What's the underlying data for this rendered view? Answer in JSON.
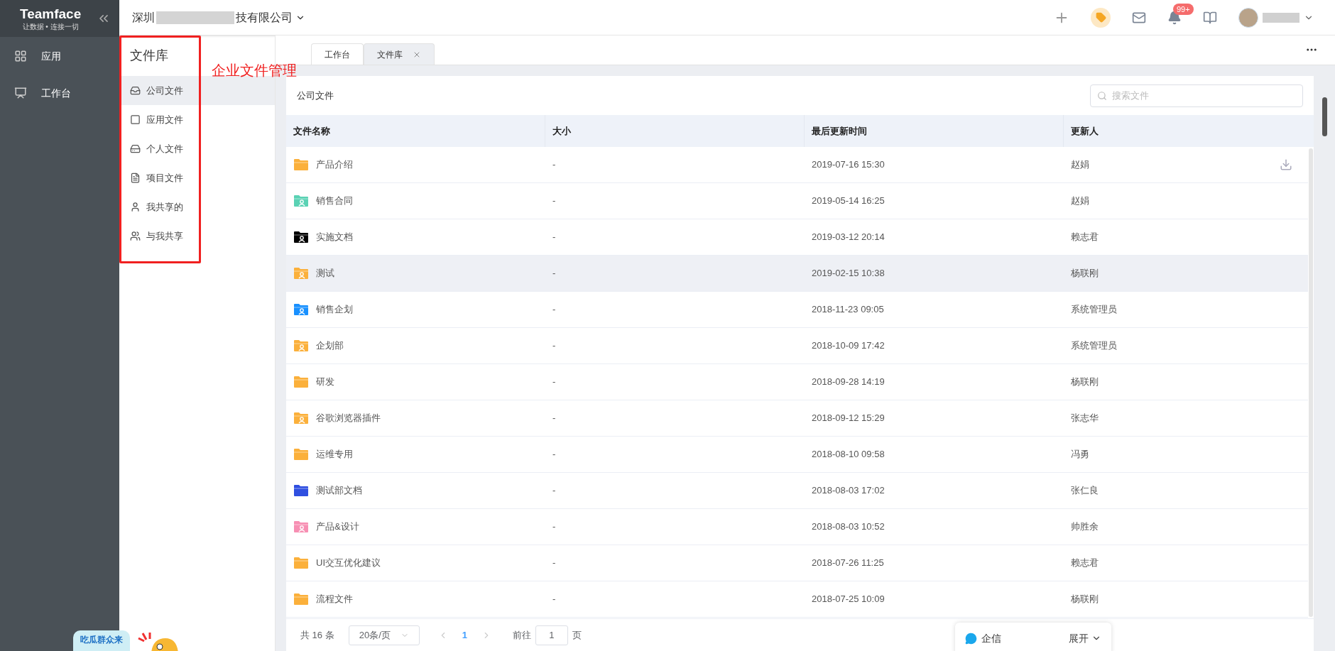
{
  "brand": {
    "name": "Teamface",
    "slogan": "让数据 • 连接一切"
  },
  "nav": [
    {
      "label": "应用",
      "kind": "apps"
    },
    {
      "label": "工作台",
      "kind": "dashboard"
    }
  ],
  "company": {
    "prefix": "深圳",
    "suffix": "技有限公司"
  },
  "header": {
    "badge": "99+"
  },
  "library": {
    "title": "文件库",
    "annotation": "企业文件管理",
    "items": [
      {
        "label": "公司文件",
        "kind": "inbox",
        "selected": true
      },
      {
        "label": "应用文件",
        "kind": "app",
        "selected": false
      },
      {
        "label": "个人文件",
        "kind": "drive",
        "selected": false
      },
      {
        "label": "项目文件",
        "kind": "project",
        "selected": false
      },
      {
        "label": "我共享的",
        "kind": "user",
        "selected": false
      },
      {
        "label": "与我共享",
        "kind": "shared",
        "selected": false
      }
    ]
  },
  "tabs": [
    {
      "label": "工作台",
      "selected": false,
      "closable": false
    },
    {
      "label": "文件库",
      "selected": true,
      "closable": true
    }
  ],
  "toolbar": {
    "title": "公司文件",
    "search": {
      "placeholder": "搜索文件"
    }
  },
  "table": {
    "columns": [
      "文件名称",
      "大小",
      "最后更新时间",
      "更新人"
    ],
    "rows": [
      {
        "name": "产品介绍",
        "color": "#fbb03b",
        "shared": false,
        "size": "-",
        "time": "2019-07-16 15:30",
        "user": "赵娟",
        "selected": false,
        "download": true
      },
      {
        "name": "销售合同",
        "color": "#5ad2b4",
        "shared": true,
        "size": "-",
        "time": "2019-05-14 16:25",
        "user": "赵娟",
        "selected": false,
        "download": false
      },
      {
        "name": "实施文档",
        "color": "#000000",
        "shared": true,
        "size": "-",
        "time": "2019-03-12 20:14",
        "user": "赖志君",
        "selected": false,
        "download": false
      },
      {
        "name": "测试",
        "color": "#fbb03b",
        "shared": true,
        "size": "-",
        "time": "2019-02-15 10:38",
        "user": "杨联刚",
        "selected": true,
        "download": false
      },
      {
        "name": "销售企划",
        "color": "#1890ff",
        "shared": true,
        "size": "-",
        "time": "2018-11-23 09:05",
        "user": "系统管理员",
        "selected": false,
        "download": false
      },
      {
        "name": "企划部",
        "color": "#fbb03b",
        "shared": true,
        "size": "-",
        "time": "2018-10-09 17:42",
        "user": "系统管理员",
        "selected": false,
        "download": false
      },
      {
        "name": "研发",
        "color": "#fbb03b",
        "shared": false,
        "size": "-",
        "time": "2018-09-28 14:19",
        "user": "杨联刚",
        "selected": false,
        "download": false
      },
      {
        "name": "谷歌浏览器插件",
        "color": "#fbb03b",
        "shared": true,
        "size": "-",
        "time": "2018-09-12 15:29",
        "user": "张志华",
        "selected": false,
        "download": false
      },
      {
        "name": "运维专用",
        "color": "#fbb03b",
        "shared": false,
        "size": "-",
        "time": "2018-08-10 09:58",
        "user": "冯勇",
        "selected": false,
        "download": false
      },
      {
        "name": "测试部文档",
        "color": "#2f4fe0",
        "shared": false,
        "size": "-",
        "time": "2018-08-03 17:02",
        "user": "张仁良",
        "selected": false,
        "download": false
      },
      {
        "name": "产品&设计",
        "color": "#f78fb3",
        "shared": true,
        "size": "-",
        "time": "2018-08-03 10:52",
        "user": "帅胜余",
        "selected": false,
        "download": false
      },
      {
        "name": "UI交互优化建议",
        "color": "#fbb03b",
        "shared": false,
        "size": "-",
        "time": "2018-07-26 11:25",
        "user": "赖志君",
        "selected": false,
        "download": false
      },
      {
        "name": "流程文件",
        "color": "#fbb03b",
        "shared": false,
        "size": "-",
        "time": "2018-07-25 10:09",
        "user": "杨联刚",
        "selected": false,
        "download": false
      }
    ]
  },
  "pager": {
    "total": "共 16 条",
    "page_size": "20条/页",
    "current": "1",
    "goto_label": "前往",
    "goto_value": "1",
    "goto_unit": "页"
  },
  "chat": {
    "label": "企信",
    "toggle": "展开"
  },
  "promo": {
    "text": "吃瓜群众来"
  }
}
